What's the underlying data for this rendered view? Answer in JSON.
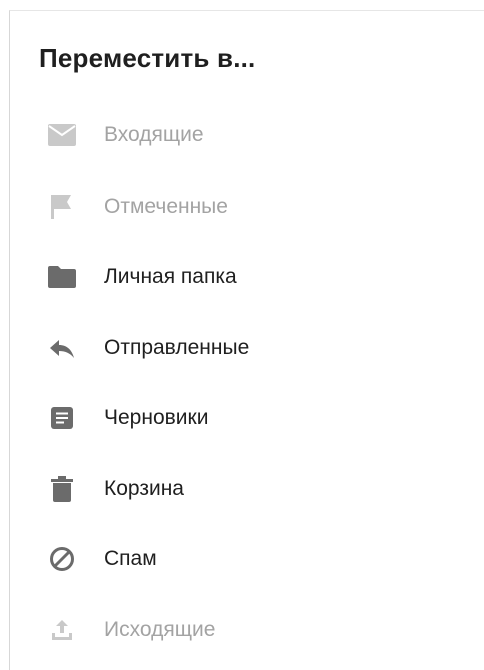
{
  "dialog": {
    "title": "Переместить в..."
  },
  "colors": {
    "icon_enabled": "#6b6b6b",
    "icon_disabled": "#c9c9c9",
    "text_enabled": "#1f1f1f",
    "text_disabled": "#a3a3a3"
  },
  "folders": [
    {
      "label": "Входящие",
      "icon": "envelope-icon",
      "enabled": false
    },
    {
      "label": "Отмеченные",
      "icon": "flag-icon",
      "enabled": false
    },
    {
      "label": "Личная папка",
      "icon": "folder-icon",
      "enabled": true
    },
    {
      "label": "Отправленные",
      "icon": "reply-icon",
      "enabled": true
    },
    {
      "label": "Черновики",
      "icon": "draft-icon",
      "enabled": true
    },
    {
      "label": "Корзина",
      "icon": "trash-icon",
      "enabled": true
    },
    {
      "label": "Спам",
      "icon": "spam-icon",
      "enabled": true
    },
    {
      "label": "Исходящие",
      "icon": "upload-icon",
      "enabled": false
    }
  ]
}
